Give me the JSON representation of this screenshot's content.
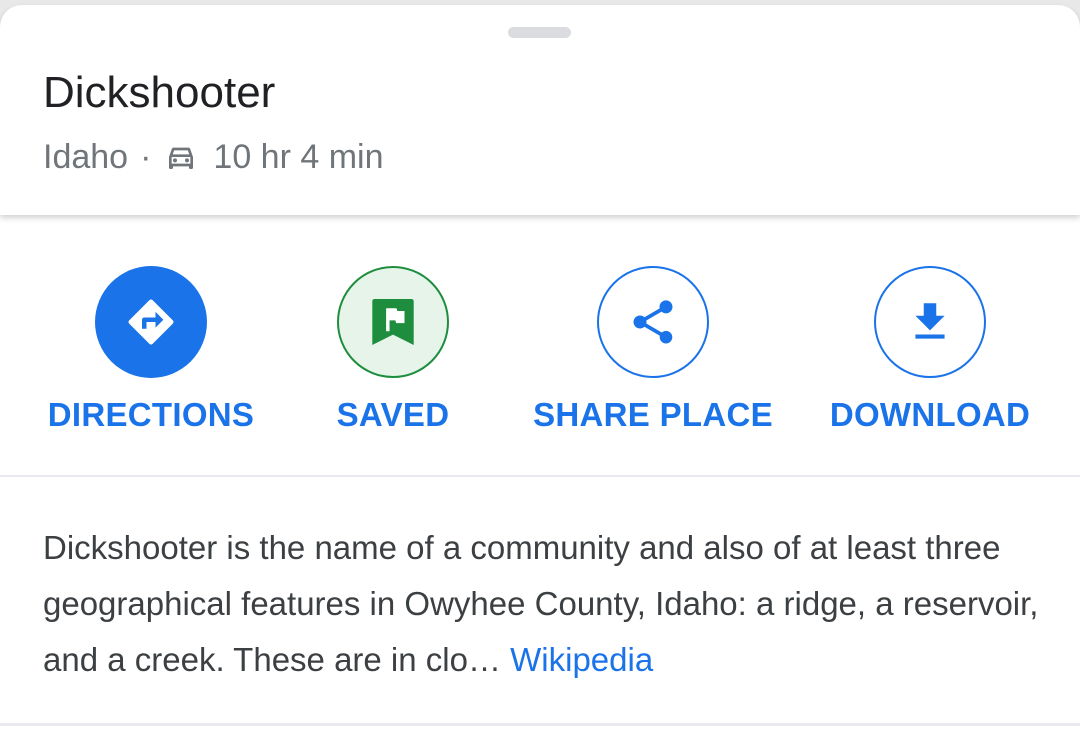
{
  "place": {
    "title": "Dickshooter",
    "region": "Idaho",
    "separator": "·",
    "travel_mode_icon": "car-icon",
    "travel_time": "10 hr 4 min"
  },
  "actions": [
    {
      "label": "DIRECTIONS",
      "icon": "directions-icon"
    },
    {
      "label": "SAVED",
      "icon": "flag-icon"
    },
    {
      "label": "SHARE PLACE",
      "icon": "share-icon"
    },
    {
      "label": "DOWNLOAD",
      "icon": "download-icon"
    }
  ],
  "description": {
    "text": "Dickshooter is the name of a community and also of at least three geographical features in Owyhee County, Idaho: a ridge, a reservoir, and a creek. These are in clo… ",
    "source_link": "Wikipedia"
  },
  "colors": {
    "accent": "#1a73e8",
    "saved_green": "#1e8e3e",
    "saved_bg": "#e6f4ea",
    "text_primary": "#202124",
    "text_secondary": "#70757a"
  }
}
